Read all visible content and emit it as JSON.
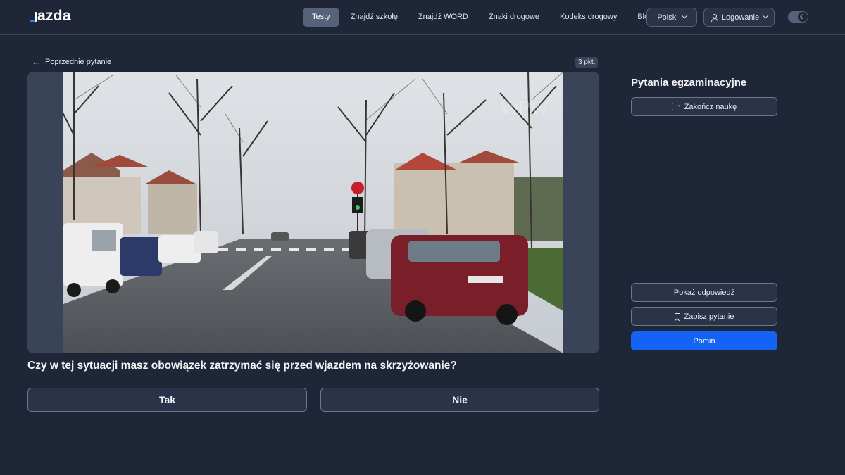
{
  "header": {
    "logo": "jazda",
    "nav": [
      "Testy",
      "Znajdź szkołę",
      "Znajdź WORD",
      "Znaki drogowe",
      "Kodeks drogowy",
      "Blog"
    ],
    "active_nav": "Testy",
    "language": "Polski",
    "login": "Logowanie",
    "theme_icon": "moon-icon"
  },
  "question_panel": {
    "back_label": "Poprzednie pytanie",
    "points": "3 pkt.",
    "question": "Czy w tej sytuacji masz obowiązek zatrzymać się przed wjazdem na skrzyżowanie?",
    "answers": [
      "Tak",
      "Nie"
    ]
  },
  "sidebar": {
    "title": "Pytania egzaminacyjne",
    "end_label": "Zakończ naukę",
    "show_answer_label": "Pokaż odpowiedź",
    "save_label": "Zapisz pytanie",
    "skip_label": "Pomiń"
  },
  "colors": {
    "background": "#1e2638",
    "accent": "#1463f5",
    "active_nav": "#56627a"
  }
}
